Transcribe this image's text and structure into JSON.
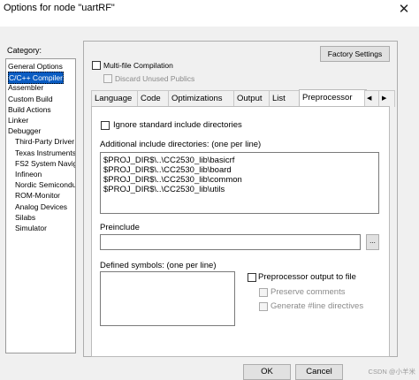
{
  "window": {
    "title": "Options for node \"uartRF\"",
    "close_glyph": "✕"
  },
  "category": {
    "label": "Category:",
    "items": [
      {
        "label": "General Options"
      },
      {
        "label": "C/C++ Compiler",
        "selected": true
      },
      {
        "label": "Assembler"
      },
      {
        "label": "Custom Build"
      },
      {
        "label": "Build Actions"
      },
      {
        "label": "Linker"
      },
      {
        "label": "Debugger"
      },
      {
        "label": "Third-Party Driver"
      },
      {
        "label": "Texas Instruments"
      },
      {
        "label": "FS2 System Navig..."
      },
      {
        "label": "Infineon"
      },
      {
        "label": "Nordic Semiconduc"
      },
      {
        "label": "ROM-Monitor"
      },
      {
        "label": "Analog Devices"
      },
      {
        "label": "Silabs"
      },
      {
        "label": "Simulator"
      }
    ]
  },
  "header": {
    "factory_settings": "Factory Settings",
    "multifile": "Multi-file Compilation",
    "discard_unused": "Discard Unused Publics"
  },
  "tabs": [
    {
      "label": "Language"
    },
    {
      "label": "Code"
    },
    {
      "label": "Optimizations"
    },
    {
      "label": "Output"
    },
    {
      "label": "List"
    },
    {
      "label": "Preprocessor",
      "active": true
    }
  ],
  "tab_scroll": {
    "left": "◀",
    "right": "▶"
  },
  "preprocessor": {
    "ignore_std": "Ignore standard include directories",
    "include_label": "Additional include directories: (one per line)",
    "include_dirs": "$PROJ_DIR$\\..\\CC2530_lib\\basicrf\n$PROJ_DIR$\\..\\CC2530_lib\\board\n$PROJ_DIR$\\..\\CC2530_lib\\common\n$PROJ_DIR$\\..\\CC2530_lib\\utils",
    "preinclude_label": "Preinclude",
    "preinclude_value": "",
    "browse": "...",
    "defined_label": "Defined symbols: (one per line)",
    "defined_value": "",
    "pp_output": "Preprocessor output to file",
    "preserve_comments": "Preserve comments",
    "generate_line": "Generate #line directives"
  },
  "footer": {
    "ok": "OK",
    "cancel": "Cancel"
  },
  "watermark": "CSDN @小羊米"
}
